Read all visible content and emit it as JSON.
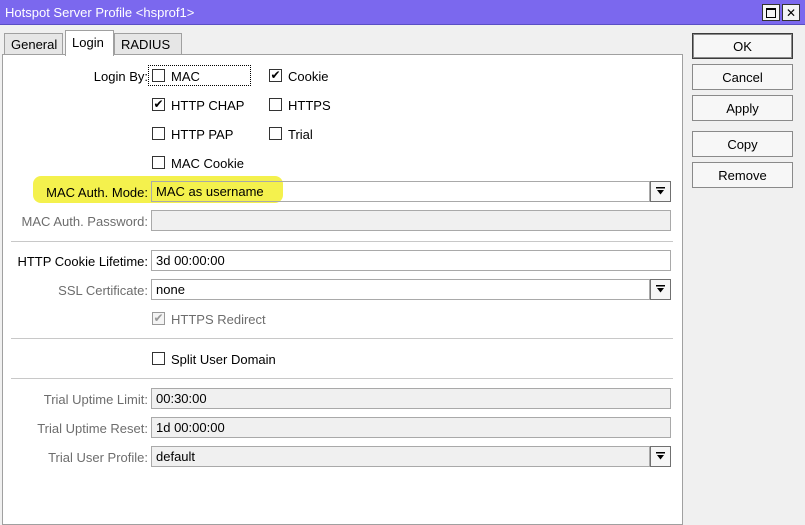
{
  "window": {
    "title": "Hotspot Server Profile <hsprof1>",
    "maximize_icon": "maximize-icon",
    "close_icon": "close-icon",
    "close_glyph": "✕"
  },
  "tabs": [
    {
      "label": "General",
      "active": false
    },
    {
      "label": "Login",
      "active": true
    },
    {
      "label": "RADIUS",
      "active": false
    }
  ],
  "login_by": {
    "label": "Login By:",
    "options": [
      {
        "label": "MAC",
        "checked": false
      },
      {
        "label": "Cookie",
        "checked": true
      },
      {
        "label": "HTTP CHAP",
        "checked": true
      },
      {
        "label": "HTTPS",
        "checked": false
      },
      {
        "label": "HTTP PAP",
        "checked": false
      },
      {
        "label": "Trial",
        "checked": false
      },
      {
        "label": "MAC Cookie",
        "checked": false
      }
    ]
  },
  "mac_auth_mode": {
    "label": "MAC Auth. Mode:",
    "value": "MAC as username"
  },
  "mac_auth_password": {
    "label": "MAC Auth. Password:",
    "value": ""
  },
  "http_cookie_lifetime": {
    "label": "HTTP Cookie Lifetime:",
    "value": "3d 00:00:00"
  },
  "ssl_certificate": {
    "label": "SSL Certificate:",
    "value": "none"
  },
  "https_redirect": {
    "label": "HTTPS Redirect",
    "checked": true
  },
  "split_user_domain": {
    "label": "Split User Domain",
    "checked": false
  },
  "trial_uptime_limit": {
    "label": "Trial Uptime Limit:",
    "value": "00:30:00"
  },
  "trial_uptime_reset": {
    "label": "Trial Uptime Reset:",
    "value": "1d 00:00:00"
  },
  "trial_user_profile": {
    "label": "Trial User Profile:",
    "value": "default"
  },
  "buttons": {
    "ok": "OK",
    "cancel": "Cancel",
    "apply": "Apply",
    "copy": "Copy",
    "remove": "Remove"
  },
  "check_glyph": "✔",
  "colors": {
    "titlebar": "#7b68ee",
    "highlight": "#f3f03a"
  }
}
